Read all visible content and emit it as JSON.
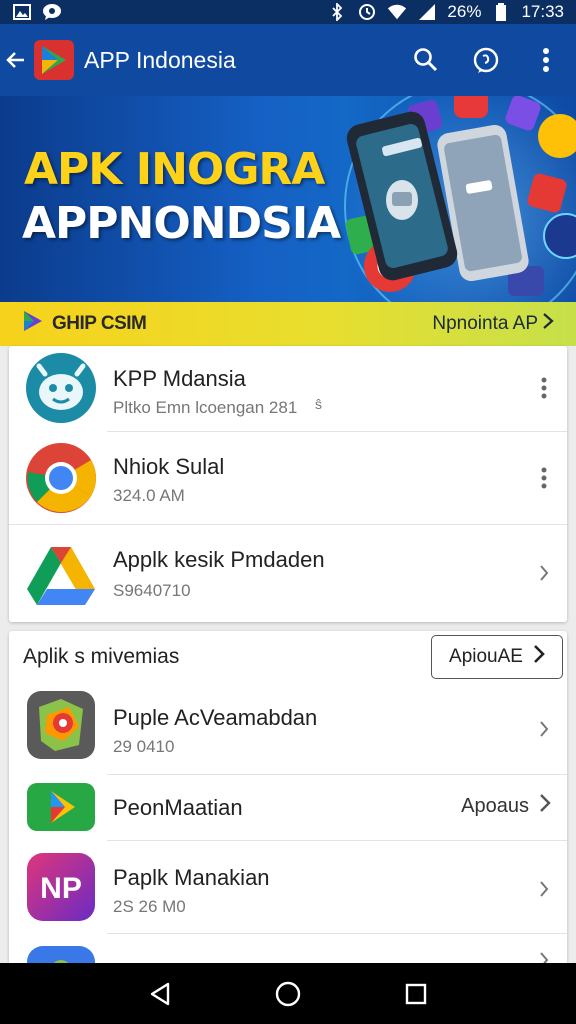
{
  "status_bar": {
    "battery_text": "26%",
    "time": "17:33",
    "icons": [
      "gallery-icon",
      "chat-bubble-icon",
      "bluetooth-icon",
      "data-sync-icon",
      "wifi-icon",
      "signal-icon",
      "battery-icon"
    ]
  },
  "app_bar": {
    "title": "APP Indonesia",
    "actions": [
      "search-icon",
      "chat-icon",
      "more-vert-icon"
    ]
  },
  "banner": {
    "line1": "APK INOGRA",
    "line2": "APPNONDSIA"
  },
  "strip": {
    "left_label": "GHIP CSIM",
    "right_label": "Npnointa AP"
  },
  "card1": {
    "items": [
      {
        "title": "KPP Mdansia",
        "subtitle": "Pltko Emn lcoengan 281",
        "extra": "ŝ",
        "action": "more-vert-icon",
        "icon": "robot-icon"
      },
      {
        "title": "Nhiok Sulal",
        "subtitle": "324.0 AM",
        "action": "more-vert-icon",
        "icon": "chrome-icon"
      },
      {
        "title": "Applk kesik Pmdaden",
        "subtitle": "S9640710",
        "action": "chevron-right-icon",
        "icon": "drive-icon"
      }
    ]
  },
  "card2": {
    "title": "Aplik s mivemias",
    "button_label": "ApiouAE",
    "items": [
      {
        "title": "Puple AcVeamabdan",
        "subtitle": "29 0410",
        "action": "chevron-right-icon",
        "icon": "maps-icon"
      },
      {
        "title": "PeonMaatian",
        "subtitle": "",
        "link_label": "Apoaus",
        "action": "chevron-right-icon",
        "icon": "play-icon"
      },
      {
        "title": "Paplk Manakian",
        "subtitle": "2S 26 M0",
        "action": "chevron-right-icon",
        "icon": "np-icon",
        "icon_text": "NP"
      },
      {
        "title": "",
        "subtitle": "",
        "action": "chevron-right-icon",
        "icon": "partial-app-icon"
      }
    ]
  },
  "nav_bar": [
    "back-icon",
    "home-icon",
    "recents-icon"
  ]
}
